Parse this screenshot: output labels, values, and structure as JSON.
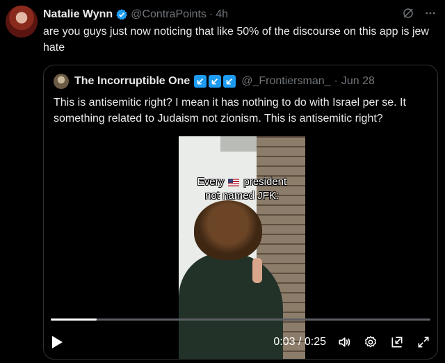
{
  "post": {
    "display_name": "Natalie Wynn",
    "handle": "@ContraPoints",
    "separator": "·",
    "time": "4h",
    "text": "are you guys just now noticing that like 50% of the discourse on this app is jew hate"
  },
  "quote": {
    "display_name": "The Incorruptible One",
    "handle": "@_Frontiersman_",
    "separator": "·",
    "date": "Jun 28",
    "text": "This is antisemitic right? I mean it has nothing to do with Israel per se. It something related to Judaism not zionism. This is antisemitic right?",
    "badges": [
      "arrow-badge",
      "arrow-badge",
      "arrow-badge"
    ]
  },
  "video": {
    "caption_line1_a": "Every",
    "caption_line1_b": "president",
    "caption_line2": "not named JFK:",
    "current_time": "0:03",
    "time_separator": "/",
    "duration": "0:25",
    "progress_fraction": 0.12
  },
  "colors": {
    "accent": "#1d9bf0",
    "muted": "#71767b",
    "text": "#e7e9ea",
    "background": "#000000"
  },
  "icons": [
    "verified-icon",
    "grok-icon",
    "more-icon",
    "play-icon",
    "volume-icon",
    "settings-icon",
    "pip-icon",
    "fullscreen-icon"
  ]
}
